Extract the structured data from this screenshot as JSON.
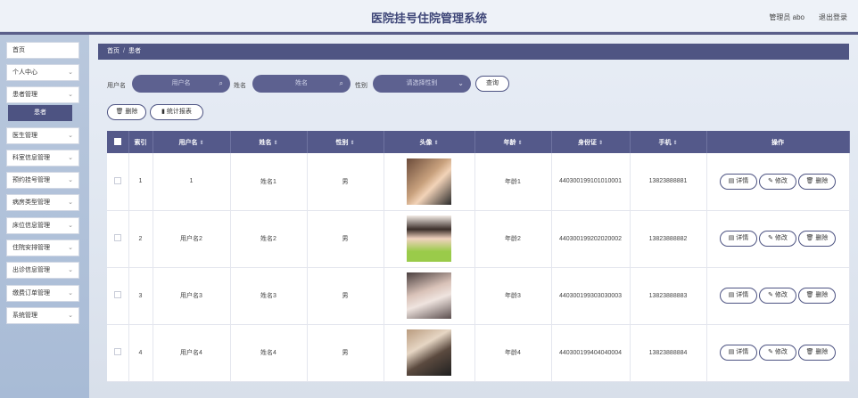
{
  "header": {
    "title": "医院挂号住院管理系统",
    "user": "管理员 abo",
    "logout": "退出登录"
  },
  "sidebar": {
    "items": [
      {
        "label": "首页",
        "chevron": false
      },
      {
        "label": "个人中心",
        "chevron": true
      },
      {
        "label": "患者管理",
        "chevron": true
      },
      {
        "label": "医生管理",
        "chevron": true
      },
      {
        "label": "科室信息管理",
        "chevron": true
      },
      {
        "label": "预约挂号管理",
        "chevron": true
      },
      {
        "label": "病房类型管理",
        "chevron": true
      },
      {
        "label": "床位信息管理",
        "chevron": true
      },
      {
        "label": "住院安排管理",
        "chevron": true
      },
      {
        "label": "出诊信息管理",
        "chevron": true
      },
      {
        "label": "缴费订单管理",
        "chevron": true
      },
      {
        "label": "系统管理",
        "chevron": true
      }
    ],
    "sub_active": "患者"
  },
  "breadcrumb": {
    "home": "首页",
    "sep": "/",
    "current": "患者"
  },
  "filters": {
    "username_label": "用户名",
    "username_placeholder": "用户名",
    "name_label": "姓名",
    "name_placeholder": "姓名",
    "gender_label": "性别",
    "gender_placeholder": "请选择性别",
    "query": "查询"
  },
  "actions": {
    "delete": "删除",
    "stats": "统计报表"
  },
  "table": {
    "columns": [
      "索引",
      "用户名",
      "姓名",
      "性别",
      "头像",
      "年龄",
      "身份证",
      "手机",
      "操作"
    ],
    "ops": {
      "detail": "详情",
      "edit": "修改",
      "delete": "删除"
    },
    "rows": [
      {
        "index": "1",
        "username": "1",
        "name": "姓名1",
        "gender": "男",
        "age": "年龄1",
        "idcard": "440300199101010001",
        "phone": "13823888881"
      },
      {
        "index": "2",
        "username": "用户名2",
        "name": "姓名2",
        "gender": "男",
        "age": "年龄2",
        "idcard": "440300199202020002",
        "phone": "13823888882"
      },
      {
        "index": "3",
        "username": "用户名3",
        "name": "姓名3",
        "gender": "男",
        "age": "年龄3",
        "idcard": "440300199303030003",
        "phone": "13823888883"
      },
      {
        "index": "4",
        "username": "用户名4",
        "name": "姓名4",
        "gender": "男",
        "age": "年龄4",
        "idcard": "440300199404040004",
        "phone": "13823888884"
      }
    ]
  },
  "colors": {
    "accent": "#4f5583",
    "sidebar": "#b1c2da"
  }
}
